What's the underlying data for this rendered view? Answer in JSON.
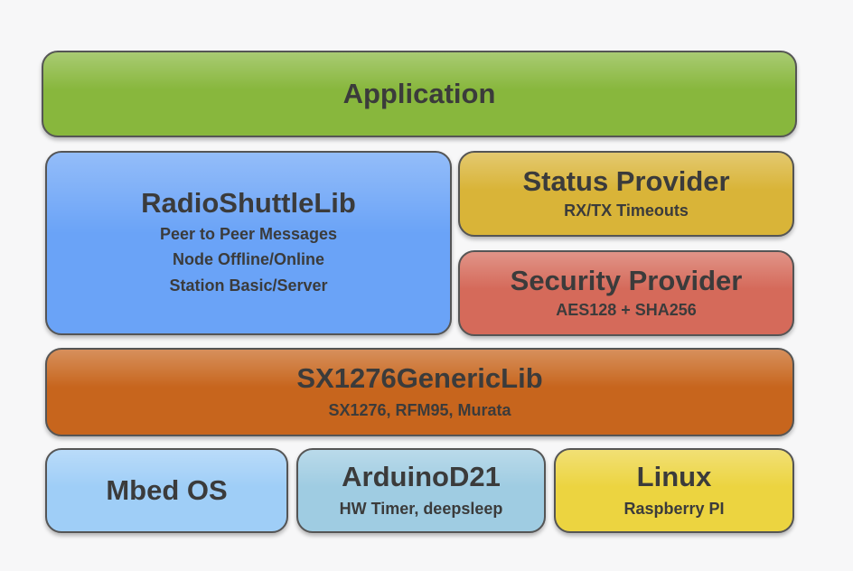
{
  "diagram": {
    "application": {
      "title": "Application",
      "color": "#88b73d"
    },
    "radioshuttle": {
      "title": "RadioShuttleLib",
      "lines": [
        "Peer to Peer Messages",
        "Node Offline/Online",
        "Station Basic/Server"
      ],
      "color": "#6aa3f7"
    },
    "status_provider": {
      "title": "Status Provider",
      "subtitle": "RX/TX Timeouts",
      "color": "#d9b438"
    },
    "security_provider": {
      "title": "Security Provider",
      "subtitle": "AES128 + SHA256",
      "color": "#d56a5a"
    },
    "sx1276": {
      "title": "SX1276GenericLib",
      "subtitle": "SX1276, RFM95, Murata",
      "color": "#c7651d"
    },
    "mbed": {
      "title": "Mbed OS",
      "color": "#9fcef7"
    },
    "arduino": {
      "title": "ArduinoD21",
      "subtitle": "HW Timer, deepsleep",
      "color": "#9fcce2"
    },
    "linux": {
      "title": "Linux",
      "subtitle": "Raspberry PI",
      "color": "#ecd440"
    }
  }
}
